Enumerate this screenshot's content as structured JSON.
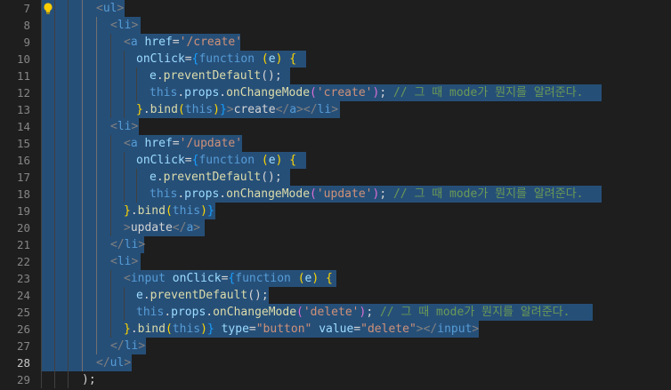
{
  "editor": {
    "language": "javascript-jsx",
    "current_line": 28,
    "hint_icon": "lightbulb-icon",
    "colors": {
      "background": "#1e1e1e",
      "selection": "#264f78",
      "line_number": "#858585",
      "tag": "#569cd6",
      "attribute": "#9cdcfe",
      "string": "#ce9178",
      "function": "#dcdcaa",
      "comment": "#6a9955"
    },
    "lines": [
      {
        "number": "7",
        "tokens": [
          {
            "t": "<",
            "c": "punc"
          },
          {
            "t": "ul",
            "c": "tag"
          },
          {
            "t": ">",
            "c": "punc"
          }
        ]
      },
      {
        "number": "8",
        "tokens": [
          {
            "t": "<",
            "c": "punc"
          },
          {
            "t": "li",
            "c": "tag"
          },
          {
            "t": ">",
            "c": "punc"
          }
        ]
      },
      {
        "number": "9",
        "tokens": [
          {
            "t": "<",
            "c": "punc"
          },
          {
            "t": "a",
            "c": "tag"
          },
          {
            "t": " ",
            "c": "text"
          },
          {
            "t": "href",
            "c": "attr"
          },
          {
            "t": "=",
            "c": "text"
          },
          {
            "t": "'/create'",
            "c": "str"
          }
        ]
      },
      {
        "number": "10",
        "tokens": [
          {
            "t": "onClick",
            "c": "attr"
          },
          {
            "t": "=",
            "c": "text"
          },
          {
            "t": "{",
            "c": "br3"
          },
          {
            "t": "function",
            "c": "kw"
          },
          {
            "t": " ",
            "c": "text"
          },
          {
            "t": "(",
            "c": "br1"
          },
          {
            "t": "e",
            "c": "param"
          },
          {
            "t": ")",
            "c": "br1"
          },
          {
            "t": " ",
            "c": "text"
          },
          {
            "t": "{",
            "c": "br1"
          }
        ]
      },
      {
        "number": "11",
        "tokens": [
          {
            "t": "e",
            "c": "param"
          },
          {
            "t": ".",
            "c": "text"
          },
          {
            "t": "preventDefault",
            "c": "fn"
          },
          {
            "t": "();",
            "c": "text"
          }
        ]
      },
      {
        "number": "12",
        "tokens": [
          {
            "t": "this",
            "c": "this"
          },
          {
            "t": ".",
            "c": "text"
          },
          {
            "t": "props",
            "c": "attr"
          },
          {
            "t": ".",
            "c": "text"
          },
          {
            "t": "onChangeMode",
            "c": "fn"
          },
          {
            "t": "(",
            "c": "br2"
          },
          {
            "t": "'create'",
            "c": "str"
          },
          {
            "t": ")",
            "c": "br2"
          },
          {
            "t": ";",
            "c": "text"
          },
          {
            "t": " ",
            "c": "text"
          },
          {
            "t": "// 그 때 mode가 뭔지를 알려준다.",
            "c": "com"
          }
        ]
      },
      {
        "number": "13",
        "tokens": [
          {
            "t": "}",
            "c": "br1"
          },
          {
            "t": ".",
            "c": "text"
          },
          {
            "t": "bind",
            "c": "fn"
          },
          {
            "t": "(",
            "c": "br1"
          },
          {
            "t": "this",
            "c": "this"
          },
          {
            "t": ")",
            "c": "br1"
          },
          {
            "t": "}",
            "c": "br3"
          },
          {
            "t": ">",
            "c": "punc"
          },
          {
            "t": "create",
            "c": "text"
          },
          {
            "t": "</",
            "c": "punc"
          },
          {
            "t": "a",
            "c": "tag"
          },
          {
            "t": "></",
            "c": "punc"
          },
          {
            "t": "li",
            "c": "tag"
          },
          {
            "t": ">",
            "c": "punc"
          }
        ]
      },
      {
        "number": "14",
        "tokens": [
          {
            "t": "<",
            "c": "punc"
          },
          {
            "t": "li",
            "c": "tag"
          },
          {
            "t": ">",
            "c": "punc"
          }
        ]
      },
      {
        "number": "15",
        "tokens": [
          {
            "t": "<",
            "c": "punc"
          },
          {
            "t": "a",
            "c": "tag"
          },
          {
            "t": " ",
            "c": "text"
          },
          {
            "t": "href",
            "c": "attr"
          },
          {
            "t": "=",
            "c": "text"
          },
          {
            "t": "'/update'",
            "c": "str"
          }
        ]
      },
      {
        "number": "16",
        "tokens": [
          {
            "t": "onClick",
            "c": "attr"
          },
          {
            "t": "=",
            "c": "text"
          },
          {
            "t": "{",
            "c": "br3"
          },
          {
            "t": "function",
            "c": "kw"
          },
          {
            "t": " ",
            "c": "text"
          },
          {
            "t": "(",
            "c": "br1"
          },
          {
            "t": "e",
            "c": "param"
          },
          {
            "t": ")",
            "c": "br1"
          },
          {
            "t": " ",
            "c": "text"
          },
          {
            "t": "{",
            "c": "br1"
          }
        ]
      },
      {
        "number": "17",
        "tokens": [
          {
            "t": "e",
            "c": "param"
          },
          {
            "t": ".",
            "c": "text"
          },
          {
            "t": "preventDefault",
            "c": "fn"
          },
          {
            "t": "();",
            "c": "text"
          }
        ]
      },
      {
        "number": "18",
        "tokens": [
          {
            "t": "this",
            "c": "this"
          },
          {
            "t": ".",
            "c": "text"
          },
          {
            "t": "props",
            "c": "attr"
          },
          {
            "t": ".",
            "c": "text"
          },
          {
            "t": "onChangeMode",
            "c": "fn"
          },
          {
            "t": "(",
            "c": "br2"
          },
          {
            "t": "'update'",
            "c": "str"
          },
          {
            "t": ")",
            "c": "br2"
          },
          {
            "t": ";",
            "c": "text"
          },
          {
            "t": " ",
            "c": "text"
          },
          {
            "t": "// 그 때 mode가 뭔지를 알려준다.",
            "c": "com"
          }
        ]
      },
      {
        "number": "19",
        "tokens": [
          {
            "t": "}",
            "c": "br1"
          },
          {
            "t": ".",
            "c": "text"
          },
          {
            "t": "bind",
            "c": "fn"
          },
          {
            "t": "(",
            "c": "br1"
          },
          {
            "t": "this",
            "c": "this"
          },
          {
            "t": ")",
            "c": "br1"
          },
          {
            "t": "}",
            "c": "br3"
          }
        ]
      },
      {
        "number": "20",
        "tokens": [
          {
            "t": ">",
            "c": "punc"
          },
          {
            "t": "update",
            "c": "text"
          },
          {
            "t": "</",
            "c": "punc"
          },
          {
            "t": "a",
            "c": "tag"
          },
          {
            "t": ">",
            "c": "punc"
          }
        ]
      },
      {
        "number": "21",
        "tokens": [
          {
            "t": "</",
            "c": "punc"
          },
          {
            "t": "li",
            "c": "tag"
          },
          {
            "t": ">",
            "c": "punc"
          }
        ]
      },
      {
        "number": "22",
        "tokens": [
          {
            "t": "<",
            "c": "punc"
          },
          {
            "t": "li",
            "c": "tag"
          },
          {
            "t": ">",
            "c": "punc"
          }
        ]
      },
      {
        "number": "23",
        "tokens": [
          {
            "t": "<",
            "c": "punc"
          },
          {
            "t": "input",
            "c": "tag"
          },
          {
            "t": " ",
            "c": "text"
          },
          {
            "t": "onClick",
            "c": "attr"
          },
          {
            "t": "=",
            "c": "text"
          },
          {
            "t": "{",
            "c": "br3"
          },
          {
            "t": "function",
            "c": "kw"
          },
          {
            "t": " ",
            "c": "text"
          },
          {
            "t": "(",
            "c": "br1"
          },
          {
            "t": "e",
            "c": "param"
          },
          {
            "t": ")",
            "c": "br1"
          },
          {
            "t": " ",
            "c": "text"
          },
          {
            "t": "{",
            "c": "br1"
          }
        ]
      },
      {
        "number": "24",
        "tokens": [
          {
            "t": "e",
            "c": "param"
          },
          {
            "t": ".",
            "c": "text"
          },
          {
            "t": "preventDefault",
            "c": "fn"
          },
          {
            "t": "();",
            "c": "text"
          }
        ]
      },
      {
        "number": "25",
        "tokens": [
          {
            "t": "this",
            "c": "this"
          },
          {
            "t": ".",
            "c": "text"
          },
          {
            "t": "props",
            "c": "attr"
          },
          {
            "t": ".",
            "c": "text"
          },
          {
            "t": "onChangeMode",
            "c": "fn"
          },
          {
            "t": "(",
            "c": "br2"
          },
          {
            "t": "'delete'",
            "c": "str"
          },
          {
            "t": ")",
            "c": "br2"
          },
          {
            "t": ";",
            "c": "text"
          },
          {
            "t": " ",
            "c": "text"
          },
          {
            "t": "// 그 때 mode가 뭔지를 알려준다.",
            "c": "com"
          }
        ]
      },
      {
        "number": "26",
        "tokens": [
          {
            "t": "}",
            "c": "br1"
          },
          {
            "t": ".",
            "c": "text"
          },
          {
            "t": "bind",
            "c": "fn"
          },
          {
            "t": "(",
            "c": "br1"
          },
          {
            "t": "this",
            "c": "this"
          },
          {
            "t": ")",
            "c": "br1"
          },
          {
            "t": "}",
            "c": "br3"
          },
          {
            "t": " ",
            "c": "text"
          },
          {
            "t": "type",
            "c": "attr"
          },
          {
            "t": "=",
            "c": "text"
          },
          {
            "t": "\"button\"",
            "c": "str"
          },
          {
            "t": " ",
            "c": "text"
          },
          {
            "t": "value",
            "c": "attr"
          },
          {
            "t": "=",
            "c": "text"
          },
          {
            "t": "\"delete\"",
            "c": "str"
          },
          {
            "t": "></",
            "c": "punc"
          },
          {
            "t": "input",
            "c": "tag"
          },
          {
            "t": ">",
            "c": "punc"
          }
        ]
      },
      {
        "number": "27",
        "tokens": [
          {
            "t": "</",
            "c": "punc"
          },
          {
            "t": "li",
            "c": "tag"
          },
          {
            "t": ">",
            "c": "punc"
          }
        ]
      },
      {
        "number": "28",
        "tokens": [
          {
            "t": "</",
            "c": "punc"
          },
          {
            "t": "ul",
            "c": "tag"
          },
          {
            "t": ">",
            "c": "punc"
          }
        ]
      },
      {
        "number": "29",
        "tokens": [
          {
            "t": ");",
            "c": "text"
          }
        ]
      }
    ]
  }
}
